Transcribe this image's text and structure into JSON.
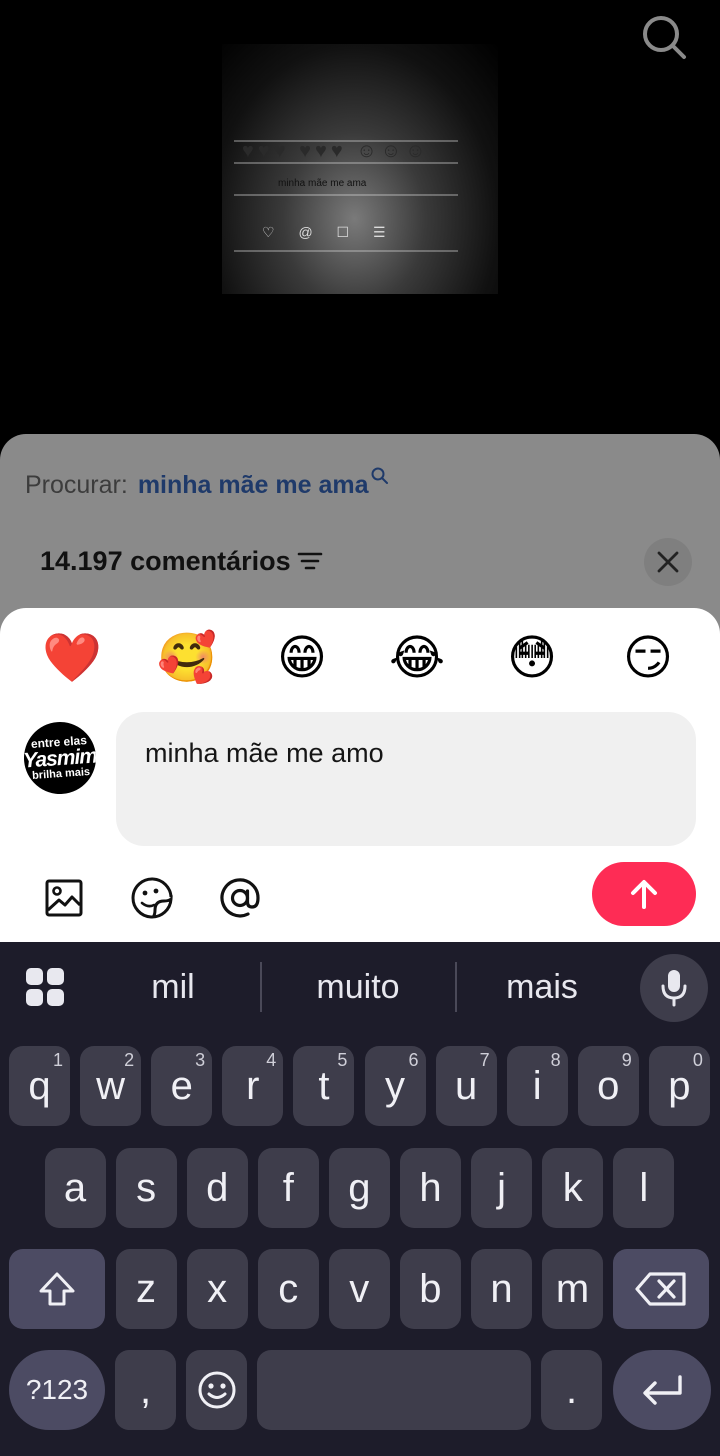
{
  "video": {
    "thumbnail_caption": "minha mãe me ama"
  },
  "comments": {
    "search_prefix": "Procurar:",
    "search_term": "minha mãe me ama",
    "count_label": "14.197 comentários"
  },
  "composer": {
    "reactions": [
      "❤️",
      "🥰",
      "😁",
      "😂",
      "😳",
      "😏"
    ],
    "avatar_text": [
      "entre elas",
      "Yasmim",
      "brilha mais"
    ],
    "input_value": "minha mãe me amo",
    "colors": {
      "send": "#fe2c55"
    }
  },
  "keyboard": {
    "suggestions": [
      "mil",
      "muito",
      "mais"
    ],
    "row1": [
      {
        "k": "q",
        "n": "1"
      },
      {
        "k": "w",
        "n": "2"
      },
      {
        "k": "e",
        "n": "3"
      },
      {
        "k": "r",
        "n": "4"
      },
      {
        "k": "t",
        "n": "5"
      },
      {
        "k": "y",
        "n": "6"
      },
      {
        "k": "u",
        "n": "7"
      },
      {
        "k": "i",
        "n": "8"
      },
      {
        "k": "o",
        "n": "9"
      },
      {
        "k": "p",
        "n": "0"
      }
    ],
    "row2": [
      "a",
      "s",
      "d",
      "f",
      "g",
      "h",
      "j",
      "k",
      "l"
    ],
    "row3": [
      "z",
      "x",
      "c",
      "v",
      "b",
      "n",
      "m"
    ],
    "symbols_label": "?123",
    "comma": ",",
    "period": "."
  }
}
